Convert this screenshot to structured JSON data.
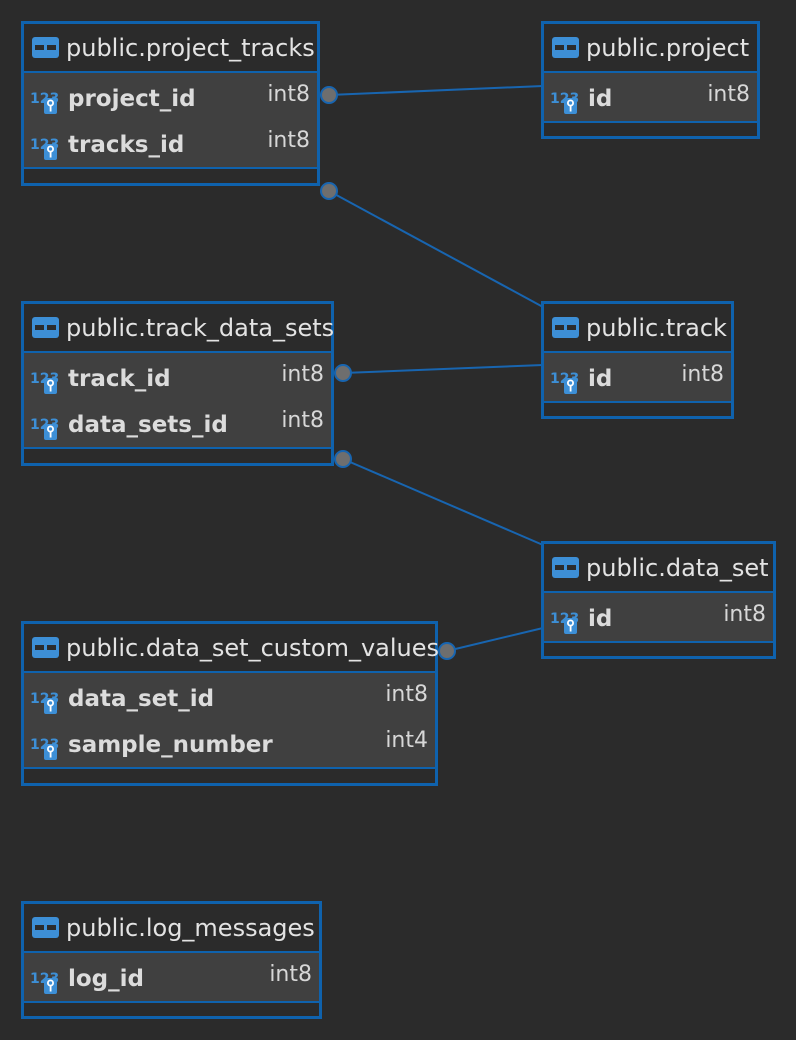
{
  "colors": {
    "background": "#2b2b2b",
    "entity_border": "#0f62ad",
    "body_fill": "#404040",
    "link_line": "#1865b0",
    "connector_dot": "#6e6e6e",
    "icon_blue": "#3d8fd6"
  },
  "key_icon": {
    "digits": "123"
  },
  "entities": {
    "project_tracks": {
      "title": "public.project_tracks",
      "columns": [
        {
          "name": "project_id",
          "type": "int8"
        },
        {
          "name": "tracks_id",
          "type": "int8"
        }
      ]
    },
    "project": {
      "title": "public.project",
      "columns": [
        {
          "name": "id",
          "type": "int8"
        }
      ]
    },
    "track_data_sets": {
      "title": "public.track_data_sets",
      "columns": [
        {
          "name": "track_id",
          "type": "int8"
        },
        {
          "name": "data_sets_id",
          "type": "int8"
        }
      ]
    },
    "track": {
      "title": "public.track",
      "columns": [
        {
          "name": "id",
          "type": "int8"
        }
      ]
    },
    "data_set": {
      "title": "public.data_set",
      "columns": [
        {
          "name": "id",
          "type": "int8"
        }
      ]
    },
    "data_set_custom_values": {
      "title": "public.data_set_custom_values",
      "columns": [
        {
          "name": "data_set_id",
          "type": "int8"
        },
        {
          "name": "sample_number",
          "type": "int4"
        }
      ]
    },
    "log_messages": {
      "title": "public.log_messages",
      "columns": [
        {
          "name": "log_id",
          "type": "int8"
        }
      ]
    }
  },
  "relationships": [
    {
      "from": "project_tracks",
      "column": "project_id",
      "to": "project"
    },
    {
      "from": "project_tracks",
      "column": "tracks_id",
      "to": "track"
    },
    {
      "from": "track_data_sets",
      "column": "track_id",
      "to": "track"
    },
    {
      "from": "track_data_sets",
      "column": "data_sets_id",
      "to": "data_set"
    },
    {
      "from": "data_set_custom_values",
      "column": "data_set_id",
      "to": "data_set"
    }
  ]
}
